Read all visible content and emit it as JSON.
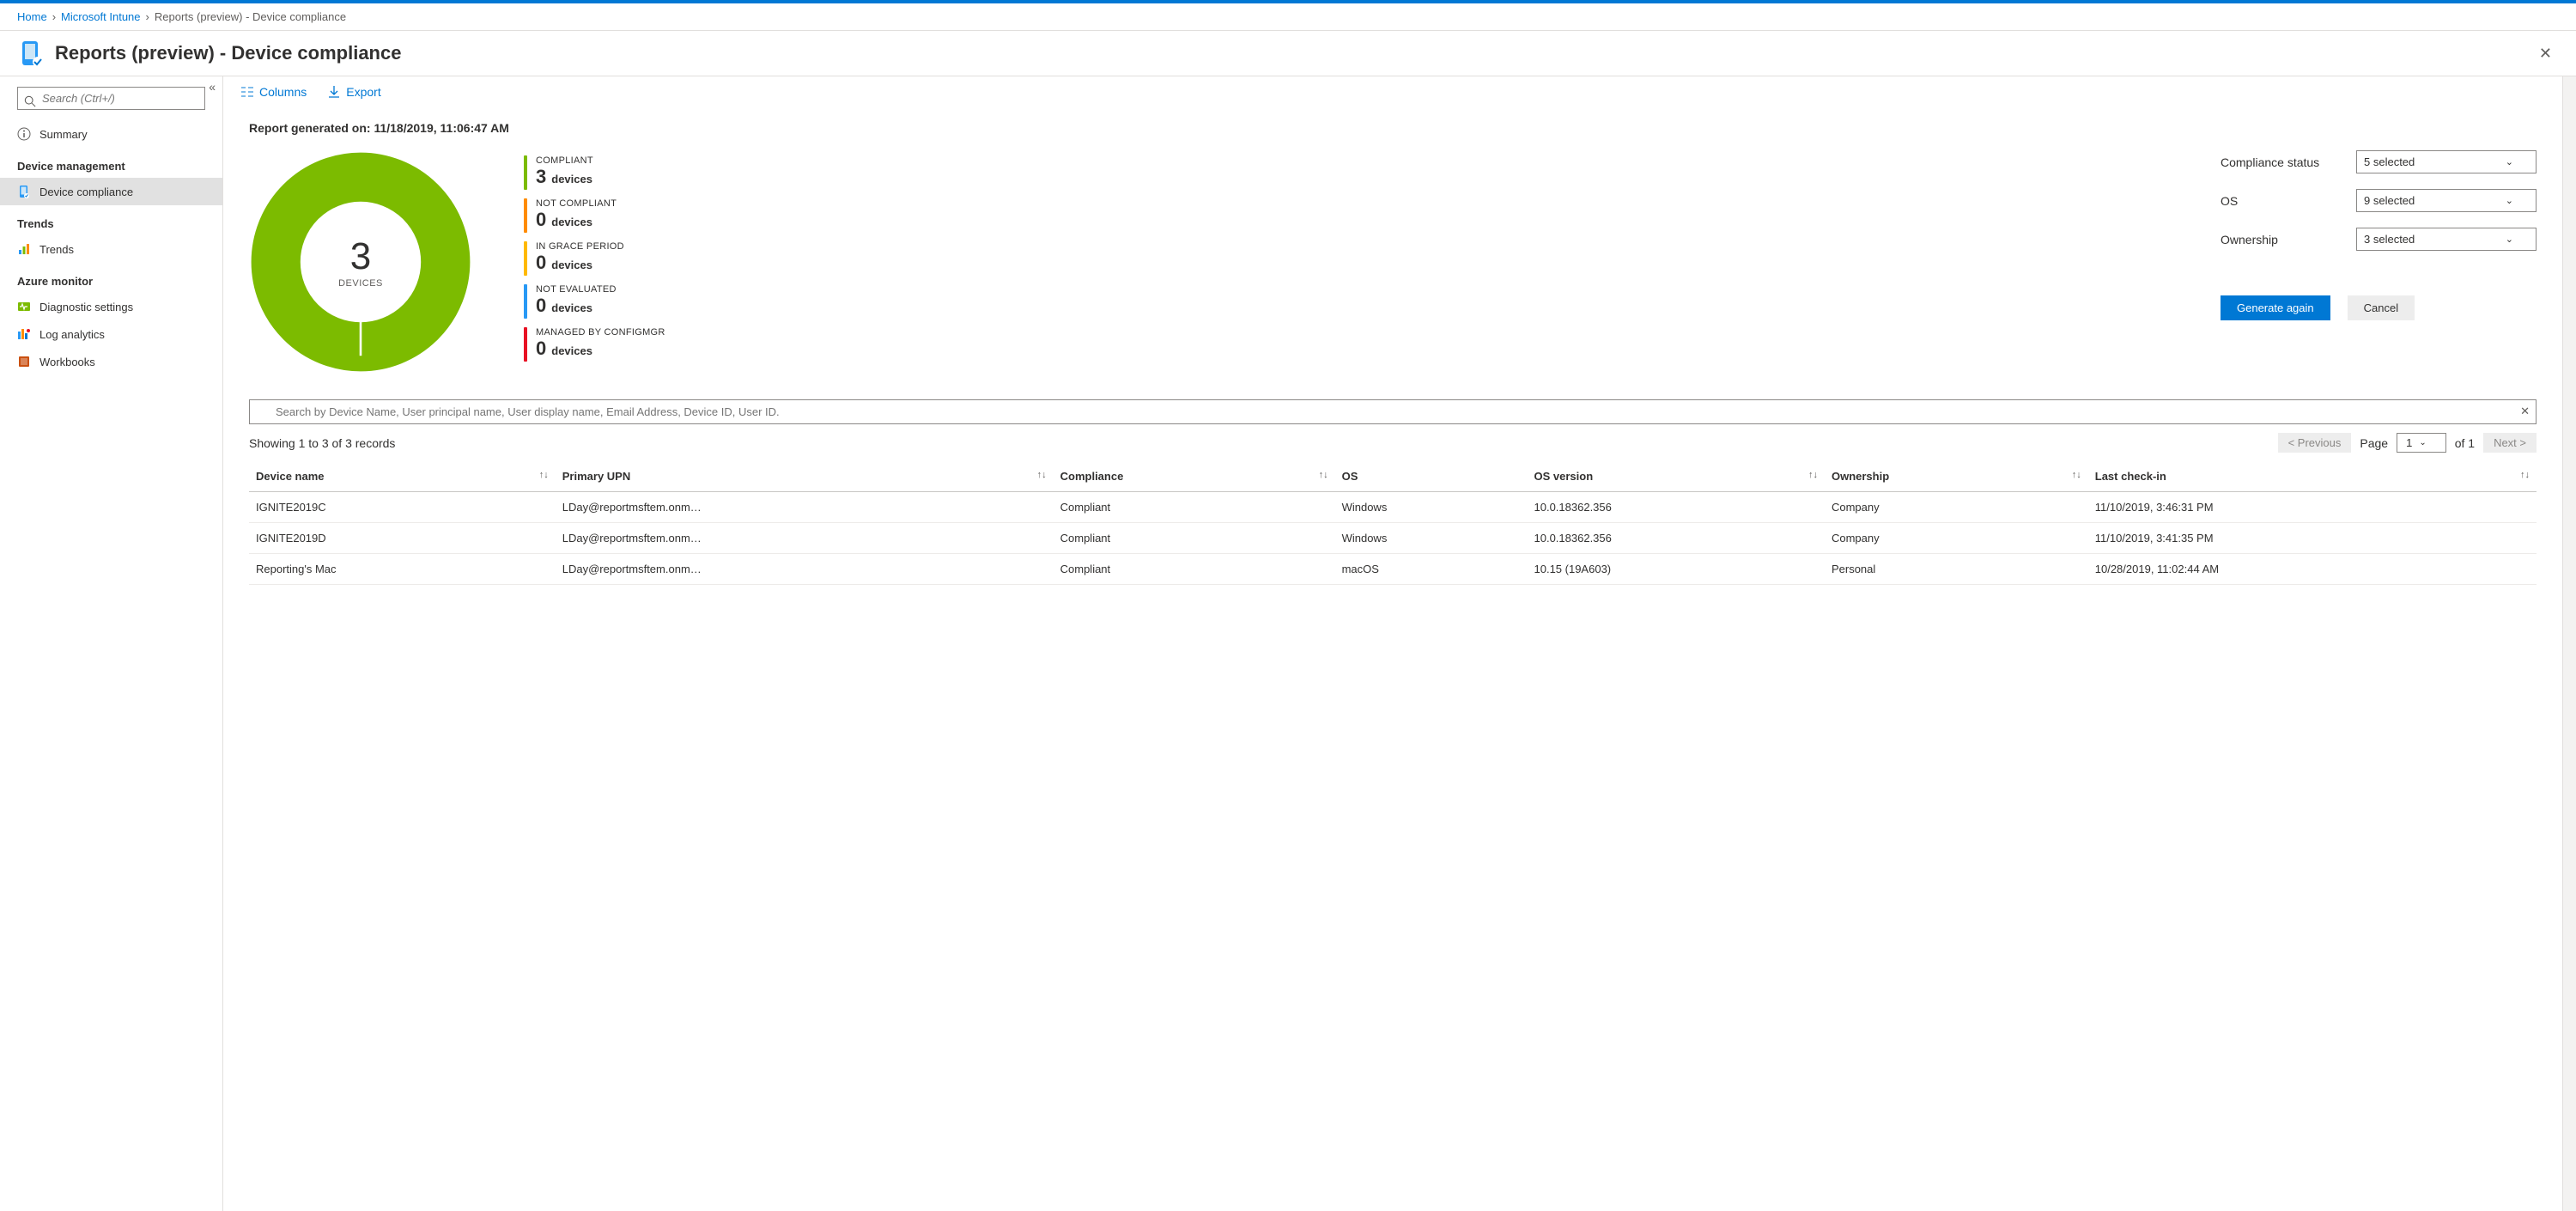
{
  "breadcrumb": {
    "home": "Home",
    "intune": "Microsoft Intune",
    "current": "Reports (preview) - Device compliance"
  },
  "page_title": "Reports (preview) - Device compliance",
  "sidebar": {
    "search_placeholder": "Search (Ctrl+/)",
    "summary": "Summary",
    "sections": {
      "device_mgmt": "Device management",
      "trends": "Trends",
      "azure_monitor": "Azure monitor"
    },
    "items": {
      "device_compliance": "Device compliance",
      "trends": "Trends",
      "diagnostic": "Diagnostic settings",
      "log_analytics": "Log analytics",
      "workbooks": "Workbooks"
    }
  },
  "commands": {
    "columns": "Columns",
    "export": "Export"
  },
  "report": {
    "generated_label": "Report generated on: 11/18/2019, 11:06:47 AM",
    "donut_count": "3",
    "donut_label": "DEVICES"
  },
  "legend": {
    "compliant": {
      "label": "COMPLIANT",
      "count": "3",
      "unit": "devices",
      "color": "#7cbb00"
    },
    "not_compliant": {
      "label": "NOT COMPLIANT",
      "count": "0",
      "unit": "devices",
      "color": "#ff8c00"
    },
    "grace": {
      "label": "IN GRACE PERIOD",
      "count": "0",
      "unit": "devices",
      "color": "#ffb900"
    },
    "not_eval": {
      "label": "NOT EVALUATED",
      "count": "0",
      "unit": "devices",
      "color": "#2899f5"
    },
    "configmgr": {
      "label": "MANAGED BY CONFIGMGR",
      "count": "0",
      "unit": "devices",
      "color": "#e81123"
    }
  },
  "filters": {
    "compliance_label": "Compliance status",
    "compliance_value": "5 selected",
    "os_label": "OS",
    "os_value": "9 selected",
    "ownership_label": "Ownership",
    "ownership_value": "3 selected",
    "generate": "Generate again",
    "cancel": "Cancel"
  },
  "table_search_placeholder": "Search by Device Name, User principal name, User display name, Email Address, Device ID, User ID.",
  "table": {
    "showing": "Showing 1 to 3 of 3 records",
    "prev": "< Previous",
    "page_label": "Page",
    "page_value": "1",
    "page_of": "of 1",
    "next": "Next >",
    "columns": {
      "device": "Device name",
      "upn": "Primary UPN",
      "compliance": "Compliance",
      "os": "OS",
      "os_version": "OS version",
      "ownership": "Ownership",
      "checkin": "Last check-in"
    },
    "rows": [
      {
        "device": "IGNITE2019C",
        "upn": "LDay@reportmsftem.onm…",
        "compliance": "Compliant",
        "os": "Windows",
        "os_version": "10.0.18362.356",
        "ownership": "Company",
        "checkin": "11/10/2019, 3:46:31 PM"
      },
      {
        "device": "IGNITE2019D",
        "upn": "LDay@reportmsftem.onm…",
        "compliance": "Compliant",
        "os": "Windows",
        "os_version": "10.0.18362.356",
        "ownership": "Company",
        "checkin": "11/10/2019, 3:41:35 PM"
      },
      {
        "device": "Reporting's Mac",
        "upn": "LDay@reportmsftem.onm…",
        "compliance": "Compliant",
        "os": "macOS",
        "os_version": "10.15 (19A603)",
        "ownership": "Personal",
        "checkin": "10/28/2019, 11:02:44 AM"
      }
    ]
  },
  "chart_data": {
    "type": "pie",
    "title": "Device compliance",
    "categories": [
      "Compliant",
      "Not compliant",
      "In grace period",
      "Not evaluated",
      "Managed by ConfigMgr"
    ],
    "values": [
      3,
      0,
      0,
      0,
      0
    ],
    "colors": [
      "#7cbb00",
      "#ff8c00",
      "#ffb900",
      "#2899f5",
      "#e81123"
    ],
    "total": 3,
    "total_label": "DEVICES"
  }
}
